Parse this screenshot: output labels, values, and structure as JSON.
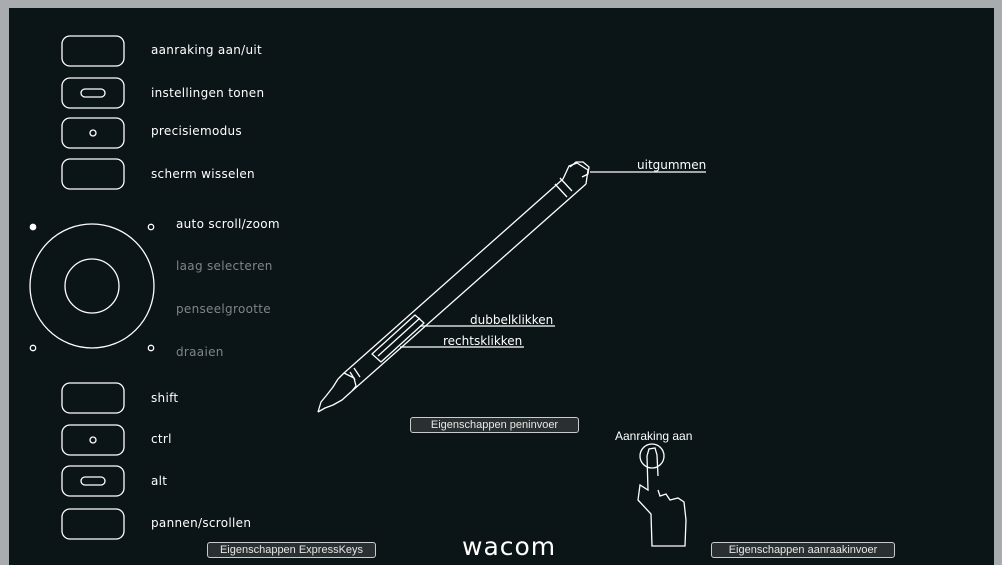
{
  "expresskeys": {
    "top": [
      {
        "label": "aanraking aan/uit",
        "mark": "none"
      },
      {
        "label": "instellingen tonen",
        "mark": "dash"
      },
      {
        "label": "precisiemodus",
        "mark": "dot"
      },
      {
        "label": "scherm wisselen",
        "mark": "none"
      }
    ],
    "bottom": [
      {
        "label": "shift",
        "mark": "none"
      },
      {
        "label": "ctrl",
        "mark": "dot"
      },
      {
        "label": "alt",
        "mark": "dash"
      },
      {
        "label": "pannen/scrollen",
        "mark": "none"
      }
    ]
  },
  "touchring": {
    "modes": [
      {
        "label": "auto scroll/zoom",
        "active": true
      },
      {
        "label": "laag selecteren",
        "active": false
      },
      {
        "label": "penseelgrootte",
        "active": false
      },
      {
        "label": "draaien",
        "active": false
      }
    ]
  },
  "pen": {
    "eraser": "uitgummen",
    "upper_button": "dubbelklikken",
    "lower_button": "rechtsklikken"
  },
  "buttons": {
    "pen_properties": "Eigenschappen peninvoer",
    "expresskeys_properties": "Eigenschappen ExpressKeys",
    "touch_properties": "Eigenschappen aanraakinvoer"
  },
  "touch": {
    "status": "Aanraking aan"
  },
  "brand": {
    "logo": "wacom"
  },
  "colors": {
    "background": "#0b1416",
    "frame": "#a9acae",
    "line": "#ffffff",
    "dim_text": "#7f8587"
  }
}
